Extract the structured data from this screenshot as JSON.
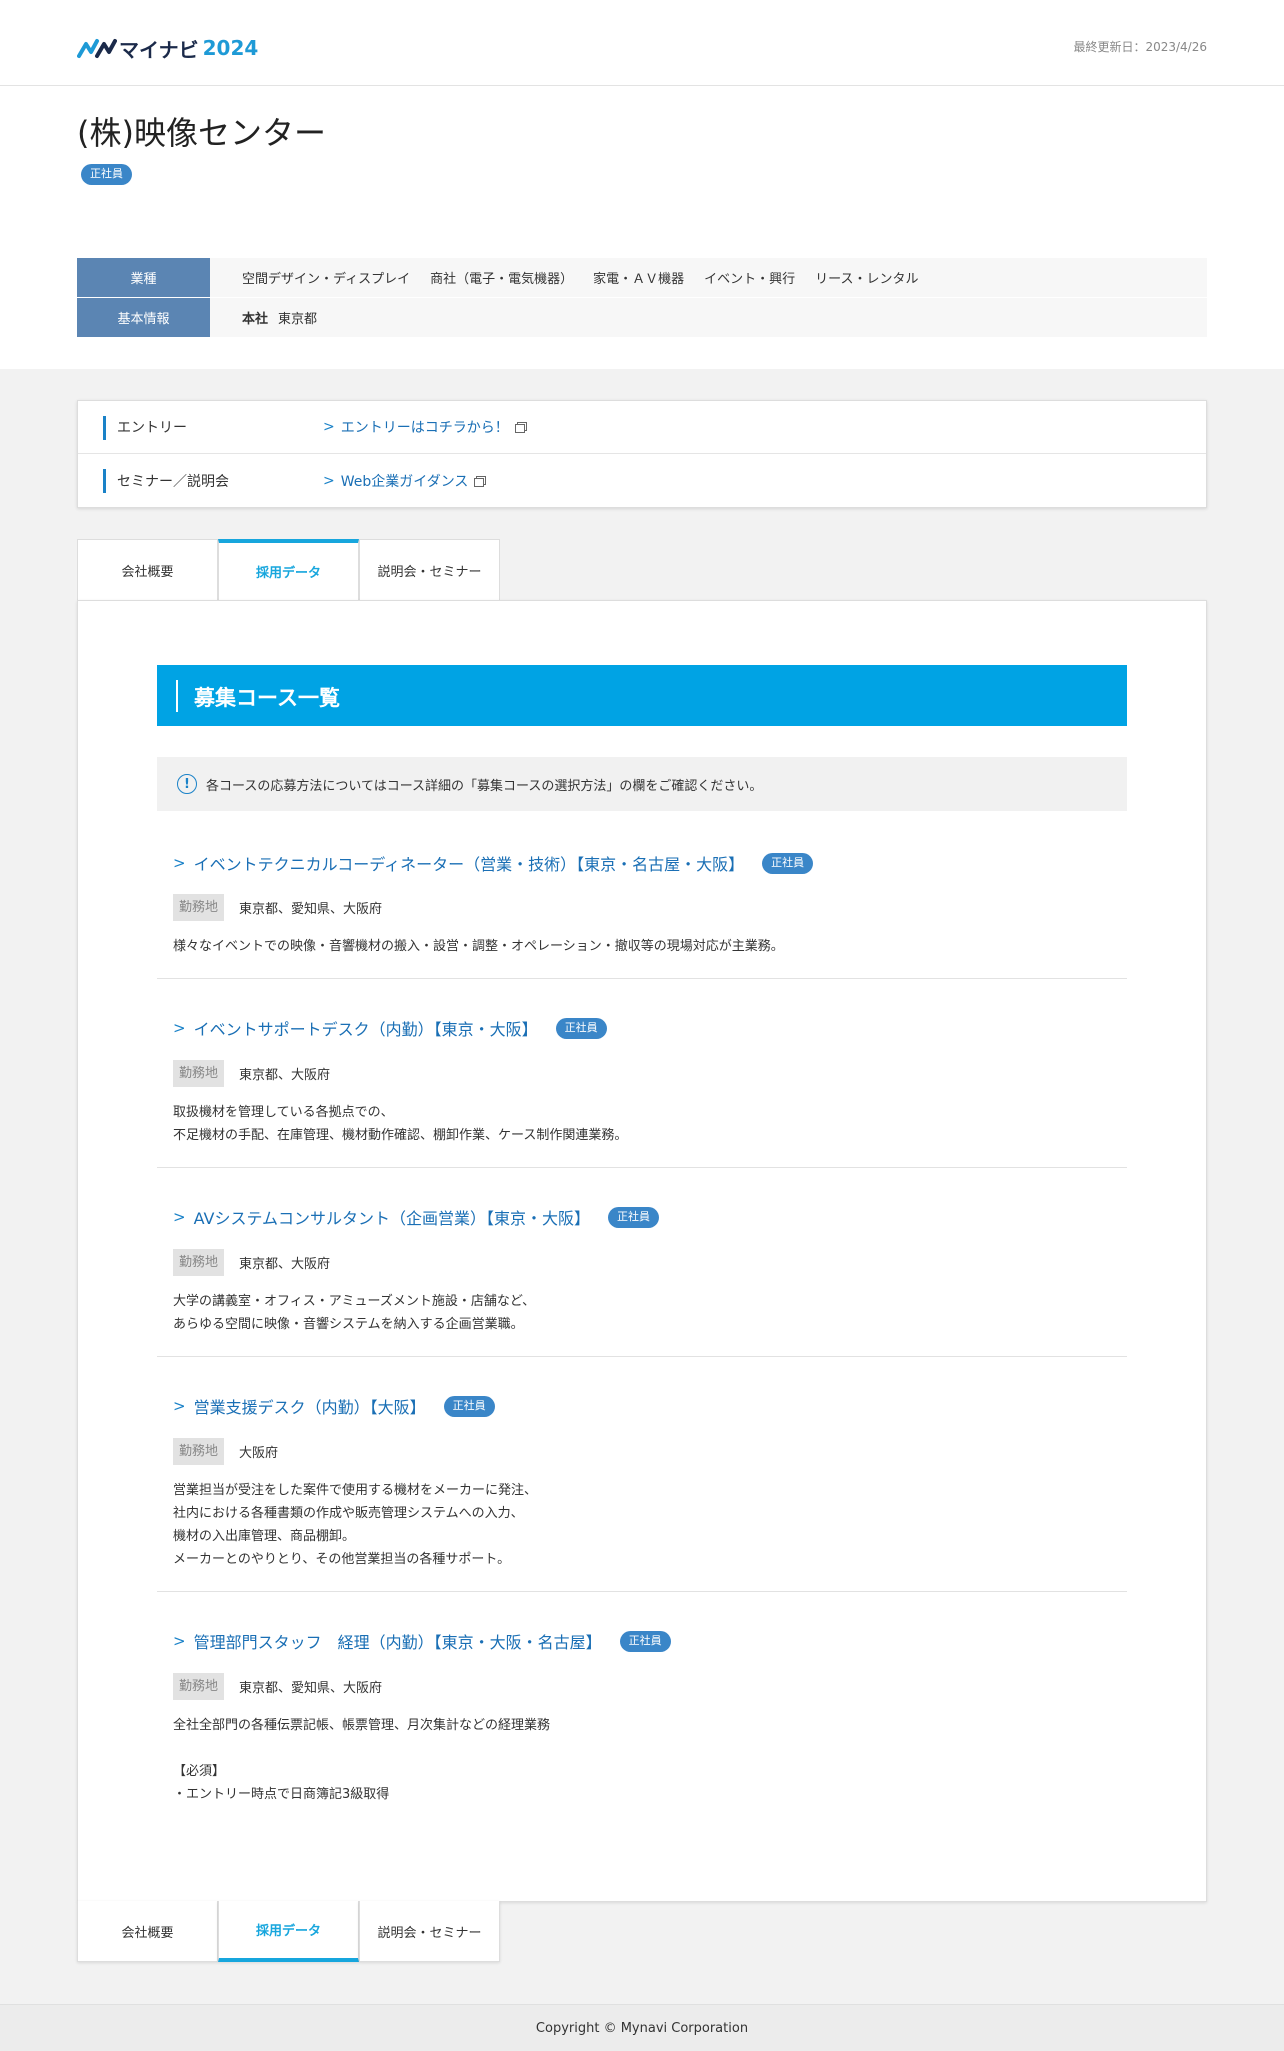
{
  "header": {
    "logo_kana": "マイナビ",
    "logo_year": "2024",
    "updated": "最終更新日：2023/4/26"
  },
  "company": {
    "name": "(株)映像センター",
    "employment_badge": "正社員",
    "industry_label": "業種",
    "industries": [
      "空間デザイン・ディスプレイ",
      "商社（電子・電気機器）",
      "家電・ＡＶ機器",
      "イベント・興行",
      "リース・レンタル"
    ],
    "basic_label": "基本情報",
    "hq_label": "本社",
    "hq_value": "東京都"
  },
  "entry": {
    "rows": [
      {
        "label": "エントリー",
        "link": "エントリーはコチラから！"
      },
      {
        "label": "セミナー／説明会",
        "link": "Web企業ガイダンス"
      }
    ]
  },
  "tabs": [
    "会社概要",
    "採用データ",
    "説明会・セミナー"
  ],
  "main": {
    "section_title": "募集コース一覧",
    "notice": "各コースの応募方法についてはコース詳細の「募集コースの選択方法」の欄をご確認ください。",
    "location_label": "勤務地",
    "courses": [
      {
        "title": "イベントテクニカルコーディネーター（営業・技術）【東京・名古屋・大阪】",
        "badge": "正社員",
        "location": "東京都、愛知県、大阪府",
        "desc": "様々なイベントでの映像・音響機材の搬入・設営・調整・オペレーション・撤収等の現場対応が主業務。"
      },
      {
        "title": "イベントサポートデスク（内勤）【東京・大阪】",
        "badge": "正社員",
        "location": "東京都、大阪府",
        "desc": "取扱機材を管理している各拠点での、\n不足機材の手配、在庫管理、機材動作確認、棚卸作業、ケース制作関連業務。"
      },
      {
        "title": "AVシステムコンサルタント（企画営業）【東京・大阪】",
        "badge": "正社員",
        "location": "東京都、大阪府",
        "desc": "大学の講義室・オフィス・アミューズメント施設・店舗など、\nあらゆる空間に映像・音響システムを納入する企画営業職。"
      },
      {
        "title": "営業支援デスク（内勤）【大阪】",
        "badge": "正社員",
        "location": "大阪府",
        "desc": "営業担当が受注をした案件で使用する機材をメーカーに発注、\n社内における各種書類の作成や販売管理システムへの入力、\n機材の入出庫管理、商品棚卸。\nメーカーとのやりとり、その他営業担当の各種サポート。"
      },
      {
        "title": "管理部門スタッフ　経理（内勤）【東京・大阪・名古屋】",
        "badge": "正社員",
        "location": "東京都、愛知県、大阪府",
        "desc": "全社全部門の各種伝票記帳、帳票管理、月次集計などの経理業務\n\n【必須】\n・エントリー時点で日商簿記3級取得"
      }
    ]
  },
  "footer": {
    "copyright": "Copyright © Mynavi Corporation"
  },
  "colors": {
    "accent": "#00a3e4",
    "badge": "#3a86c8",
    "link": "#1a6fb5",
    "label_bg": "#5b85b3"
  }
}
